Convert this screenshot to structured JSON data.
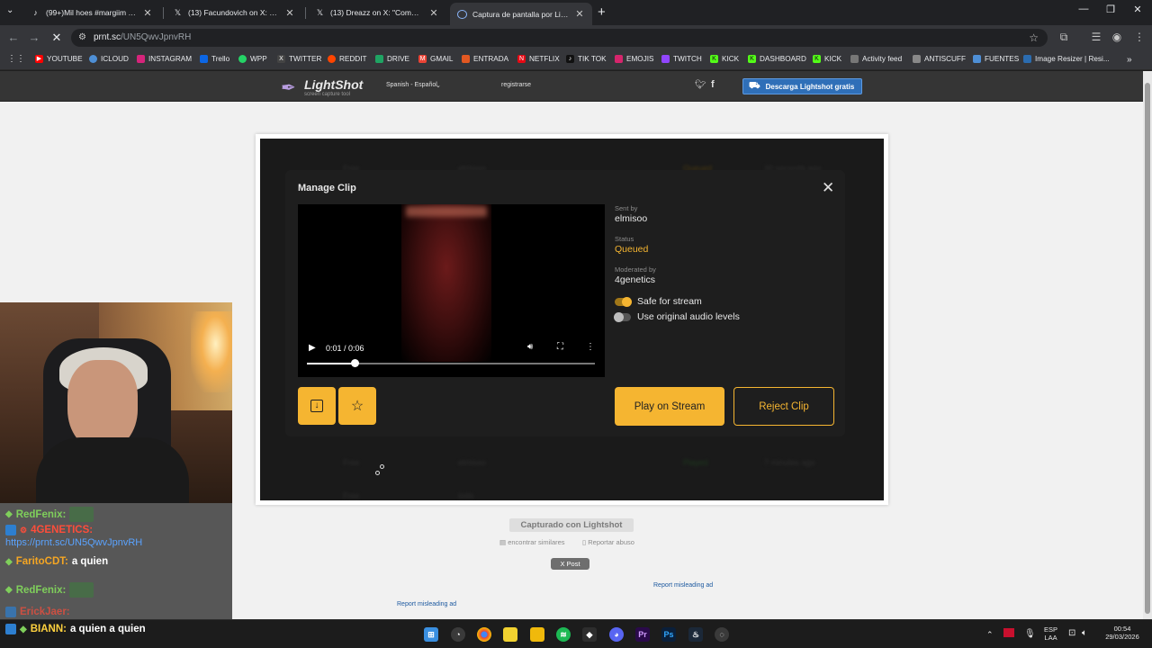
{
  "browser": {
    "tabs": [
      {
        "title": "(99+)Mil hoes #margiim #asan",
        "icon": "tiktok-icon"
      },
      {
        "title": "(13) Facundovich on X: \"https://",
        "icon": "x-icon"
      },
      {
        "title": "(13) Dreazz on X: \"Como dolist",
        "icon": "x-icon"
      },
      {
        "title": "Captura de pantalla por Lightsh",
        "icon": "loading-icon",
        "active": true
      }
    ],
    "url_host": "prnt.sc",
    "url_path": "/UN5QwvJpnvRH",
    "bookmarks": [
      {
        "label": "YOUTUBE",
        "color": "#ff0000"
      },
      {
        "label": "ICLOUD",
        "color": "#4e8fd6"
      },
      {
        "label": "INSTAGRAM",
        "color": "#d6247b"
      },
      {
        "label": "Trello",
        "color": "#0c66e4"
      },
      {
        "label": "WPP",
        "color": "#25d366"
      },
      {
        "label": "TWITTER",
        "color": "#444444"
      },
      {
        "label": "REDDIT",
        "color": "#ff4500"
      },
      {
        "label": "DRIVE",
        "color": "#1fa463"
      },
      {
        "label": "GMAIL",
        "color": "#ea4335"
      },
      {
        "label": "ENTRADA",
        "color": "#e25822"
      },
      {
        "label": "NETFLIX",
        "color": "#e50914"
      },
      {
        "label": "TIK TOK",
        "color": "#111111"
      },
      {
        "label": "EMOJIS",
        "color": "#d6256c"
      },
      {
        "label": "TWITCH",
        "color": "#9146ff"
      },
      {
        "label": "KICK",
        "color": "#53fc18"
      },
      {
        "label": "DASHBOARD",
        "color": "#53fc18"
      },
      {
        "label": "KICK",
        "color": "#53fc18"
      },
      {
        "label": "Activity feed",
        "color": "#777777"
      },
      {
        "label": "ANTISCUFF",
        "color": "#888888"
      },
      {
        "label": "FUENTES",
        "color": "#4e8fd6"
      },
      {
        "label": "Image Resizer | Resi...",
        "color": "#2b6cb0"
      }
    ]
  },
  "lightshot": {
    "logo_name": "LightShot",
    "logo_tag": "screen capture tool",
    "language": "Spanish - Español",
    "register": "registrarse",
    "download": "Descarga Lightshot gratis",
    "captured_with": "Capturado con Lightshot",
    "find_similar": "encontrar similares",
    "report_abuse": "Reportar abuso",
    "x_post": "X Post",
    "report_ad": "Report misleading ad"
  },
  "clip_modal": {
    "title": "Manage Clip",
    "sent_by_label": "Sent by",
    "sent_by": "elmisoo",
    "status_label": "Status",
    "status": "Queued",
    "moderated_by_label": "Moderated by",
    "moderated_by": "4genetics",
    "safe_for_stream": "Safe for stream",
    "safe_for_stream_on": true,
    "original_audio": "Use original audio levels",
    "original_audio_on": false,
    "video_time": "0:01 / 0:06",
    "video_progress": 0.167,
    "play_on_stream": "Play on Stream",
    "reject_clip": "Reject Clip",
    "bg_rows": [
      {
        "a": "Free",
        "b": "elmisoo",
        "c": "Queued",
        "d": "30 seconds ago"
      },
      {
        "a": "Free",
        "b": "elmisoo",
        "c": "Played",
        "d": "7 minutes ago"
      },
      {
        "a": "Free",
        "b": "todo",
        "c": "",
        "d": ""
      }
    ]
  },
  "chat": {
    "lines": [
      {
        "user": "RedFenix:",
        "text": "",
        "color": "#7fcf5b"
      },
      {
        "user": "4GENETICS:",
        "text": "",
        "color": "#ff4d3a"
      },
      {
        "user": "",
        "text": "https://prnt.sc/UN5QwvJpnvRH",
        "color": "#5aa3ff"
      },
      {
        "user": "FaritoCDT:",
        "text": "a quien",
        "color": "#f5a623"
      },
      {
        "user": "RedFenix:",
        "text": "",
        "color": "#7fcf5b"
      },
      {
        "user": "ErickJaer:",
        "text": "",
        "color": "#ff4d3a"
      },
      {
        "user": "BIANN:",
        "text": "a quien a quien",
        "color": "#ffd23f"
      }
    ]
  },
  "taskbar": {
    "lang1": "ESP",
    "lang2": "LAA",
    "time": "00:54",
    "date": "29/03/2026"
  }
}
